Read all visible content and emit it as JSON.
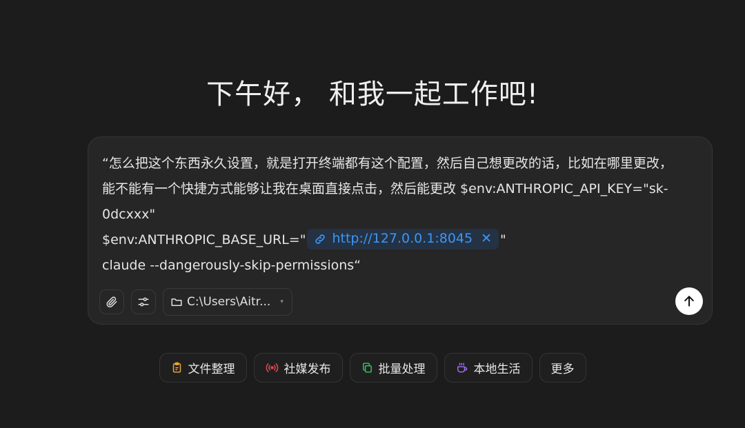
{
  "greeting": "下午好， 和我一起工作吧!",
  "composer": {
    "text_lines": [
      "“怎么把这个东西永久设置，就是打开终端都有这个配置，然后自己想更改的话，比如在哪里更改，",
      "能不能有一个快捷方式能够让我在桌面直接点击，然后能更改 $env:ANTHROPIC_API_KEY=\"sk-",
      "0dcxxx\""
    ],
    "line4_prefix": "$env:ANTHROPIC_BASE_URL=\"",
    "link_chip": {
      "url": "http://127.0.0.1:8045",
      "close_glyph": "✕",
      "icon": "link-icon"
    },
    "line4_suffix": "\"",
    "line5": "claude --dangerously-skip-permissions“",
    "toolbar": {
      "attach_icon": "paperclip-icon",
      "settings_icon": "sliders-icon",
      "folder_path": "C:\\Users\\Aitr...",
      "folder_icon": "folder-icon"
    },
    "send_icon": "arrow-up-icon"
  },
  "quick_actions": [
    {
      "label": "文件整理",
      "icon": "clipboard-icon",
      "color": "#e8a13a"
    },
    {
      "label": "社媒发布",
      "icon": "broadcast-icon",
      "color": "#e5484d"
    },
    {
      "label": "批量处理",
      "icon": "copy-icon",
      "color": "#2fbf5b"
    },
    {
      "label": "本地生活",
      "icon": "coffee-icon",
      "color": "#9b6cf2"
    },
    {
      "label": "更多",
      "icon": "",
      "color": ""
    }
  ],
  "colors": {
    "background": "#1c1c1c",
    "composer_bg": "#262626",
    "link": "#3d97f2"
  }
}
